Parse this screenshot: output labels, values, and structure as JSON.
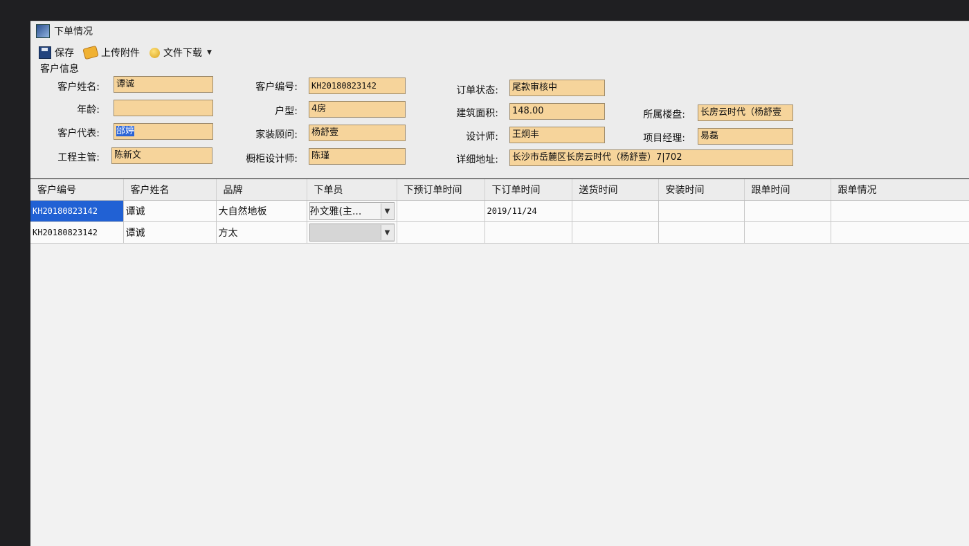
{
  "window": {
    "title": "下单情况"
  },
  "toolbar": {
    "save": "保存",
    "upload": "上传附件",
    "download": "文件下载"
  },
  "group": {
    "title": "客户信息"
  },
  "form": {
    "customer_name": {
      "label": "客户姓名:",
      "value": "谭诚"
    },
    "age": {
      "label": "年龄:",
      "value": ""
    },
    "customer_rep": {
      "label": "客户代表:",
      "value": "邰婷"
    },
    "engineering_supervisor": {
      "label": "工程主管:",
      "value": "陈新文"
    },
    "customer_id": {
      "label": "客户编号:",
      "value": "KH20180823142"
    },
    "house_type": {
      "label": "户型:",
      "value": "4房"
    },
    "home_consultant": {
      "label": "家装顾问:",
      "value": "杨舒壹"
    },
    "cabinet_designer": {
      "label": "橱柜设计师:",
      "value": "陈瑾"
    },
    "order_status": {
      "label": "订单状态:",
      "value": "尾款审核中"
    },
    "building_area": {
      "label": "建筑面积:",
      "value": "148.00"
    },
    "designer": {
      "label": "设计师:",
      "value": "王炯丰"
    },
    "detailed_address": {
      "label": "详细地址:",
      "value": "长沙市岳麓区长房云时代（杨舒壹）7|702"
    },
    "property": {
      "label": "所属楼盘:",
      "value": "长房云时代（杨舒壹"
    },
    "project_manager": {
      "label": "项目经理:",
      "value": "易磊"
    }
  },
  "grid": {
    "columns": [
      "客户编号",
      "客户姓名",
      "品牌",
      "下单员",
      "下预订单时间",
      "下订单时间",
      "送货时间",
      "安装时间",
      "跟单时间",
      "跟单情况"
    ],
    "rows": [
      {
        "customer_id": "KH20180823142",
        "name": "谭诚",
        "brand": "大自然地板",
        "orderer": "孙文雅(主...",
        "pre_order_time": "",
        "order_time": "2019/11/24",
        "delivery_time": "",
        "install_time": "",
        "follow_time": "",
        "follow_status": ""
      },
      {
        "customer_id": "KH20180823142",
        "name": "谭诚",
        "brand": "方太",
        "orderer": "",
        "pre_order_time": "",
        "order_time": "",
        "delivery_time": "",
        "install_time": "",
        "follow_time": "",
        "follow_status": ""
      }
    ]
  }
}
